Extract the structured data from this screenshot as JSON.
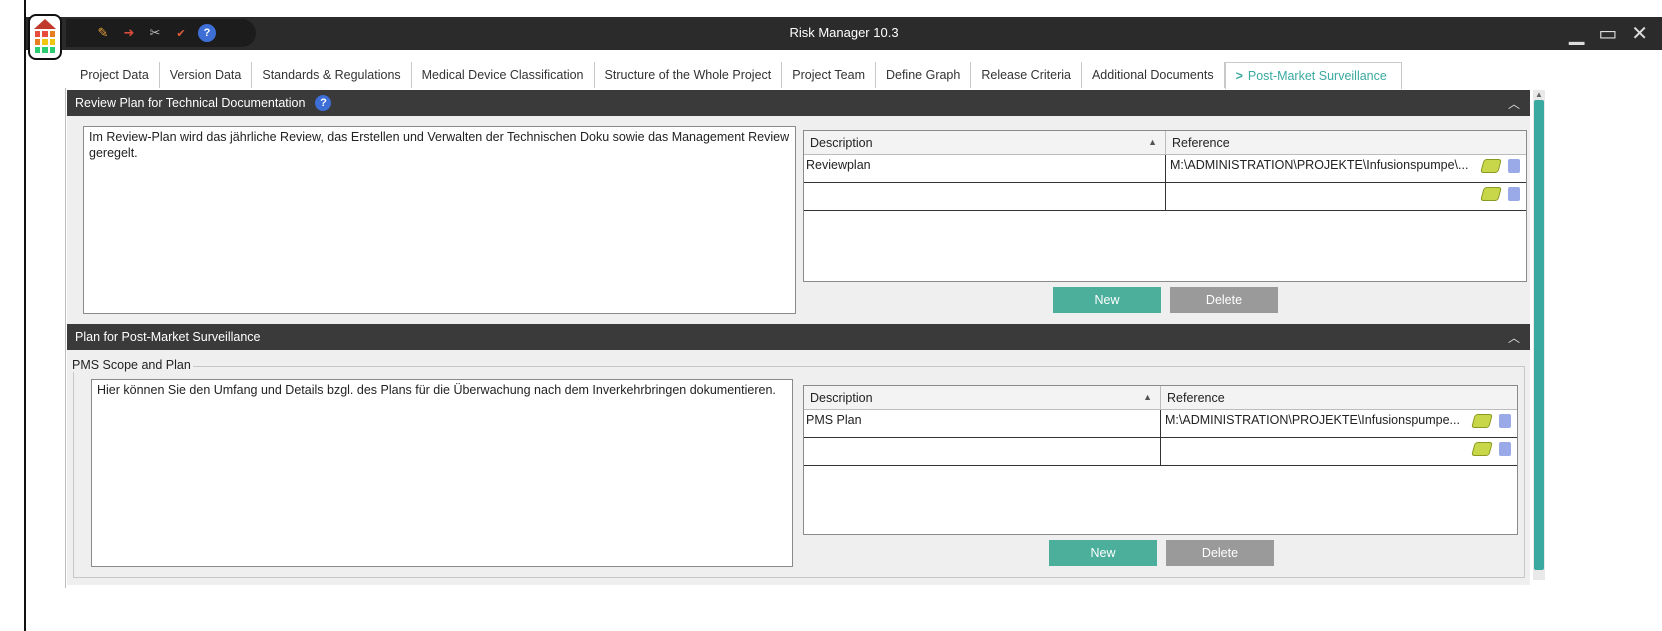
{
  "window": {
    "title": "Risk Manager  10.3",
    "controls": [
      "minimize",
      "maximize",
      "close"
    ]
  },
  "quick_toolbar": {
    "icons": [
      "pen-icon",
      "import-icon",
      "tools-icon",
      "spellcheck-icon",
      "help-icon"
    ],
    "help_label": "?"
  },
  "tabs": [
    {
      "label": "Project Data"
    },
    {
      "label": "Version Data"
    },
    {
      "label": "Standards & Regulations"
    },
    {
      "label": "Medical Device Classification"
    },
    {
      "label": "Structure of the Whole Project"
    },
    {
      "label": "Project Team"
    },
    {
      "label": "Define Graph"
    },
    {
      "label": "Release Criteria"
    },
    {
      "label": "Additional Documents"
    },
    {
      "label": "Post-Market Surveillance",
      "active": true,
      "prefix": ">"
    }
  ],
  "review_section": {
    "title": "Review Plan for Technical Documentation",
    "help": "?",
    "text": "Im Review-Plan wird das jährliche Review, das Erstellen und Verwalten der Technischen Doku sowie das Management Review geregelt.",
    "table": {
      "col_description": "Description",
      "col_reference": "Reference",
      "rows": [
        {
          "description": "Reviewplan",
          "reference": "M:\\ADMINISTRATION\\PROJEKTE\\Infusionspumpe\\..."
        },
        {
          "description": "",
          "reference": ""
        }
      ]
    },
    "new_label": "New",
    "delete_label": "Delete"
  },
  "pms_section": {
    "title": "Plan for Post-Market Surveillance",
    "group_label": "PMS Scope and Plan",
    "text": "Hier können Sie den Umfang und Details bzgl. des Plans für die Überwachung nach dem Inverkehrbringen dokumentieren.",
    "table": {
      "col_description": "Description",
      "col_reference": "Reference",
      "rows": [
        {
          "description": "PMS Plan",
          "reference": "M:\\ADMINISTRATION\\PROJEKTE\\Infusionspumpe..."
        },
        {
          "description": "",
          "reference": ""
        }
      ]
    },
    "new_label": "New",
    "delete_label": "Delete"
  },
  "colors": {
    "accent": "#3aa9a0",
    "titlebar": "#2b2b2b",
    "section_header": "#3a3a3a",
    "new_button": "#4caf9c",
    "delete_button": "#9a9a9a"
  }
}
